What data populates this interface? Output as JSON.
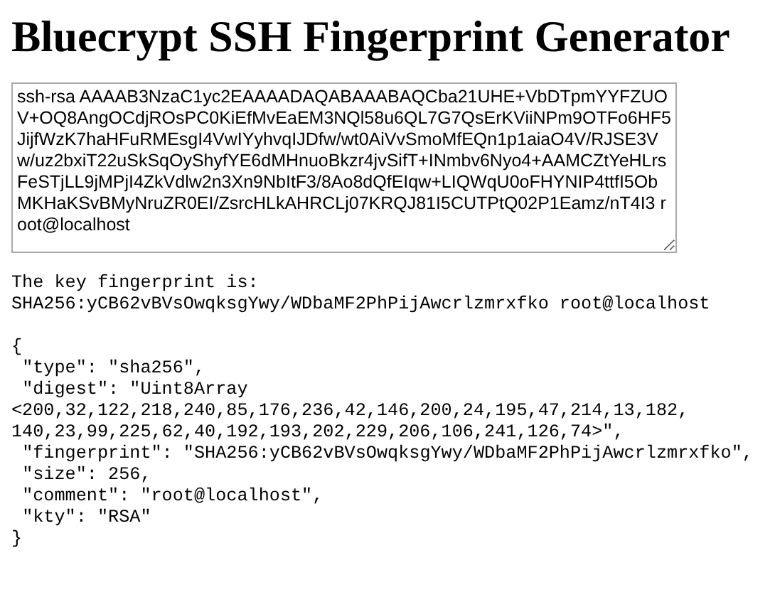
{
  "title": "Bluecrypt SSH Fingerprint Generator",
  "key_input": {
    "value": "ssh-rsa AAAAB3NzaC1yc2EAAAADAQABAAABAQCba21UHE+VbDTpmYYFZUOV+OQ8AngOCdjROsPC0KiEfMvEaEM3NQl58u6QL7G7QsErKViiNPm9OTFo6HF5JijfWzK7haHFuRMEsgI4VwIYyhvqIJDfw/wt0AiVvSmoMfEQn1p1aiaO4V/RJSE3Vw/uz2bxiT22uSkSqOyShyfYE6dMHnuoBkzr4jvSifT+INmbv6Nyo4+AAMCZtYeHLrsFeSTjLL9jMPjI4ZkVdlw2n3Xn9NbItF3/8Ao8dQfEIqw+LIQWqU0oFHYNIP4ttfI5ObMKHaKSvBMyNruZR0EI/ZsrcHLkAHRCLj07KRQJ81I5CUTPtQ02P1Eamz/nT4I3 root@localhost"
  },
  "result_label": "The key fingerprint is:",
  "fingerprint": "SHA256:yCB62vBVsOwqksgYwy/WDbaMF2PhPijAwcrlzmrxfko root@localhost",
  "json_output": [
    "{",
    " \"type\": \"sha256\",",
    " \"digest\": \"Uint8Array <200,32,122,218,240,85,176,236,42,146,200,24,195,47,214,13,182, 140,23,99,225,62,40,192,193,202,229,206,106,241,126,74>\",",
    " \"fingerprint\": \"SHA256:yCB62vBVsOwqksgYwy/WDbaMF2PhPijAwcrlzmrxfko\",",
    " \"size\": 256,",
    " \"comment\": \"root@localhost\",",
    " \"kty\": \"RSA\"",
    "}"
  ]
}
